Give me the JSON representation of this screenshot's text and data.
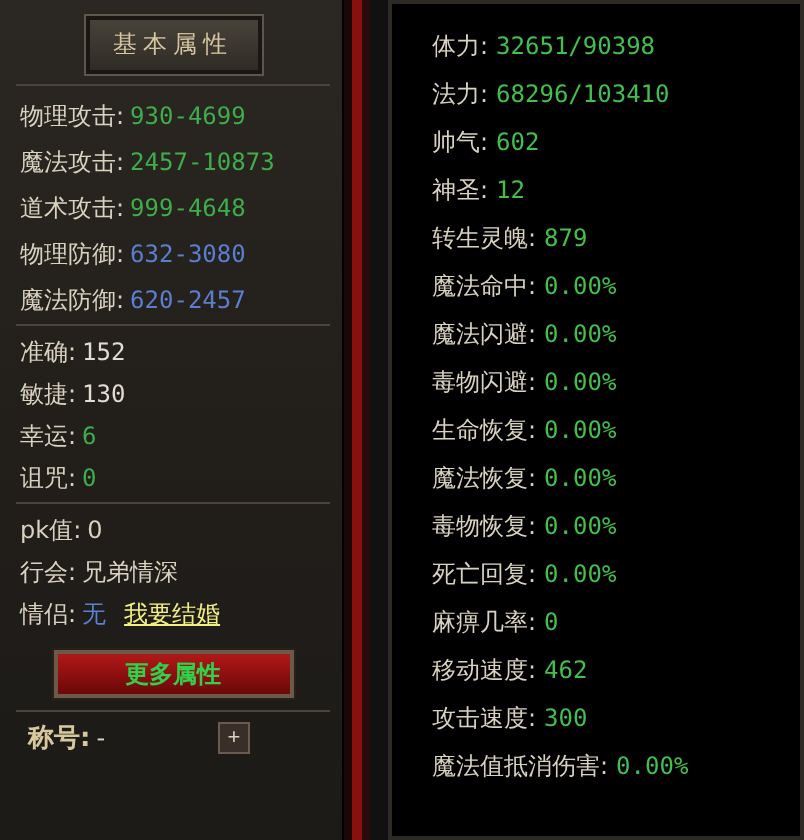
{
  "left_panel": {
    "header": "基本属性",
    "combat_stats": [
      {
        "label": "物理攻击:",
        "value": "930-4699",
        "color": "#3fae4a"
      },
      {
        "label": "魔法攻击:",
        "value": "2457-10873",
        "color": "#3fae4a"
      },
      {
        "label": "道术攻击:",
        "value": "999-4648",
        "color": "#3fae4a"
      },
      {
        "label": "物理防御:",
        "value": "632-3080",
        "color": "#5b7fd0"
      },
      {
        "label": "魔法防御:",
        "value": "620-2457",
        "color": "#5b7fd0"
      }
    ],
    "secondary_stats": [
      {
        "label": "准确:",
        "value": "152",
        "color": "#e0dcd0"
      },
      {
        "label": "敏捷:",
        "value": "130",
        "color": "#e0dcd0"
      },
      {
        "label": "幸运:",
        "value": "6",
        "color": "#3fae4a"
      },
      {
        "label": "诅咒:",
        "value": "0",
        "color": "#3fae4a"
      }
    ],
    "social": [
      {
        "label": "pk值:",
        "value": "0"
      },
      {
        "label": "行会:",
        "value": "兄弟情深"
      }
    ],
    "partner": {
      "label": "情侣:",
      "value": "无",
      "link": "我要结婚"
    },
    "more_button": "更多属性",
    "title": {
      "label": "称号:",
      "value": "-",
      "add_button": "+"
    }
  },
  "right_panel": {
    "stats": [
      {
        "label": "体力:",
        "value": "32651/90398"
      },
      {
        "label": "法力:",
        "value": "68296/103410"
      },
      {
        "label": "帅气:",
        "value": "602"
      },
      {
        "label": "神圣:",
        "value": "12"
      },
      {
        "label": "转生灵魄:",
        "value": "879"
      },
      {
        "label": "魔法命中:",
        "value": "0.00%"
      },
      {
        "label": "魔法闪避:",
        "value": "0.00%"
      },
      {
        "label": "毒物闪避:",
        "value": "0.00%"
      },
      {
        "label": "生命恢复:",
        "value": "0.00%"
      },
      {
        "label": "魔法恢复:",
        "value": "0.00%"
      },
      {
        "label": "毒物恢复:",
        "value": "0.00%"
      },
      {
        "label": "死亡回复:",
        "value": "0.00%"
      },
      {
        "label": "麻痹几率:",
        "value": "0"
      },
      {
        "label": "移动速度:",
        "value": "462"
      },
      {
        "label": "攻击速度:",
        "value": "300"
      },
      {
        "label": "魔法值抵消伤害:",
        "value": "0.00%"
      }
    ]
  }
}
